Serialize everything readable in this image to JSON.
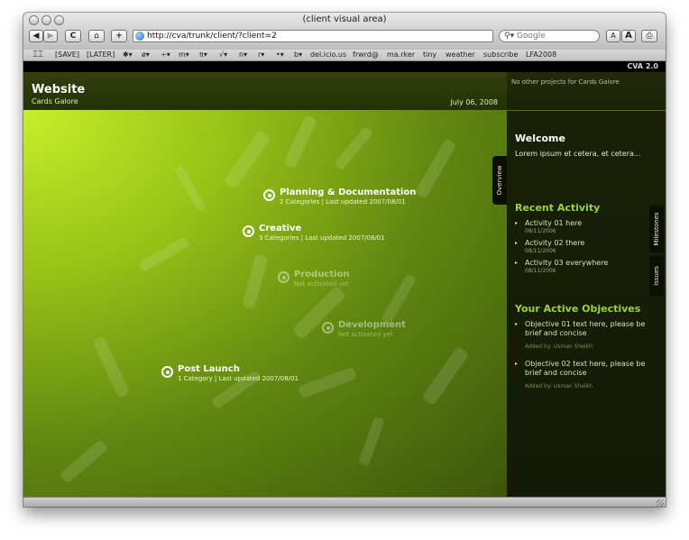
{
  "window": {
    "title": "(client visual area)"
  },
  "toolbar": {
    "back": "◀",
    "forward": "▶",
    "reload": "C",
    "home": "⌂",
    "add": "+",
    "url": "http://cva/trunk/client/?client=2",
    "search_placeholder": "Google",
    "text_smaller": "A",
    "text_larger": "A",
    "print": "⎙"
  },
  "bookmarks": {
    "book_icon": "open-book-icon",
    "items": [
      "[SAVE]",
      "[LATER]",
      "✱▾",
      "ø▾",
      "÷▾",
      "m▾",
      "π▾",
      "√▾",
      "n▾",
      "r▾",
      "•▾",
      "b▾",
      "del.icio.us",
      "frwrd@",
      "ma.rker",
      "tiny",
      "weather",
      "subscribe",
      "LFA2008"
    ]
  },
  "brand": "CVA 2.0",
  "header": {
    "title": "Website",
    "client": "Cards Galore",
    "date": "July 06, 2008"
  },
  "phases": [
    {
      "name": "Planning & Documentation",
      "info": "2 Categories | Last updated 2007/08/01",
      "active": true
    },
    {
      "name": "Creative",
      "info": "3 Categories | Last updated 2007/08/01",
      "active": true
    },
    {
      "name": "Production",
      "info": "Not activated yet",
      "active": false
    },
    {
      "name": "Development",
      "info": "Not activated yet",
      "active": false
    },
    {
      "name": "Post Launch",
      "info": "1 Category | Last updated 2007/08/01",
      "active": true
    }
  ],
  "sidebar": {
    "projects_note": "No other projects for Cards Galore",
    "welcome": {
      "title": "Welcome",
      "body": "Lorem ipsum et cetera, et cetera..."
    },
    "recent": {
      "title": "Recent Activity",
      "items": [
        {
          "text": "Activity 01 here",
          "date": "08/11/2006"
        },
        {
          "text": "Activity 02 there",
          "date": "08/11/2006"
        },
        {
          "text": "Activity 03 everywhere",
          "date": "08/11/2006"
        }
      ]
    },
    "objectives": {
      "title": "Your Active Objectives",
      "items": [
        {
          "text": "Objective 01 text here, please be brief and concise",
          "by": "Added by: Usman Sheikh"
        },
        {
          "text": "Objective 02 text here, please be brief and concise",
          "by": "Added by: Usman Sheikh"
        }
      ]
    },
    "tabs": {
      "overview": "Overview",
      "milestones": "Milestones",
      "issues": "Issues"
    }
  },
  "colors": {
    "accent_green": "#9cd23a",
    "lime": "#c7ef28",
    "dark_panel": "#141a06"
  }
}
